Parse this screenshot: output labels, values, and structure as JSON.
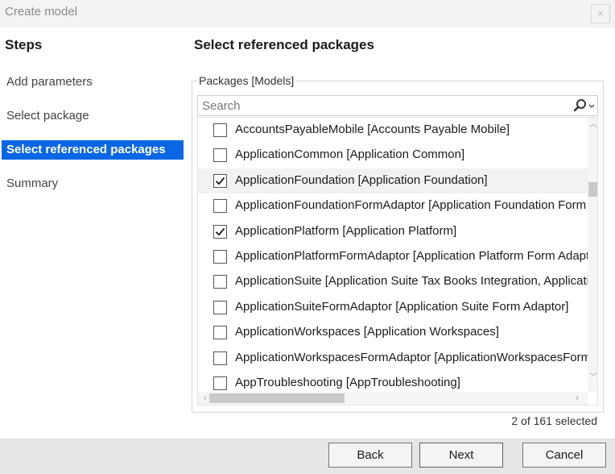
{
  "window": {
    "title": "Create model",
    "close_glyph": "×"
  },
  "steps": {
    "heading": "Steps",
    "items": [
      {
        "label": "Add parameters"
      },
      {
        "label": "Select package"
      },
      {
        "label": "Select referenced packages"
      },
      {
        "label": "Summary"
      }
    ],
    "active_index": 2
  },
  "main": {
    "heading": "Select referenced packages",
    "group_label": "Packages [Models]",
    "search": {
      "placeholder": "Search",
      "value": ""
    },
    "packages": [
      {
        "label": "AccountsPayableMobile [Accounts Payable Mobile]",
        "checked": false
      },
      {
        "label": "ApplicationCommon [Application Common]",
        "checked": false
      },
      {
        "label": "ApplicationFoundation [Application Foundation]",
        "checked": true
      },
      {
        "label": "ApplicationFoundationFormAdaptor [Application Foundation Form Adaptor]",
        "checked": false
      },
      {
        "label": "ApplicationPlatform [Application Platform]",
        "checked": true
      },
      {
        "label": "ApplicationPlatformFormAdaptor [Application Platform Form Adaptor]",
        "checked": false
      },
      {
        "label": "ApplicationSuite [Application Suite Tax Books Integration, Application Suite]",
        "checked": false
      },
      {
        "label": "ApplicationSuiteFormAdaptor [Application Suite Form Adaptor]",
        "checked": false
      },
      {
        "label": "ApplicationWorkspaces [Application Workspaces]",
        "checked": false
      },
      {
        "label": "ApplicationWorkspacesFormAdaptor [ApplicationWorkspacesFormAdaptor]",
        "checked": false
      },
      {
        "label": "AppTroubleshooting [AppTroubleshooting]",
        "checked": false
      }
    ],
    "highlighted_index": 2,
    "selection_count": "2 of 161 selected"
  },
  "footer": {
    "back_label": "Back",
    "next_label": "Next",
    "cancel_label": "Cancel"
  },
  "colors": {
    "accent": "#0a66e4",
    "footer_bg": "#e6e6e6"
  },
  "icons": {
    "search": "search-icon",
    "dropdown": "chevron-down-icon",
    "check": "checkmark-icon"
  }
}
